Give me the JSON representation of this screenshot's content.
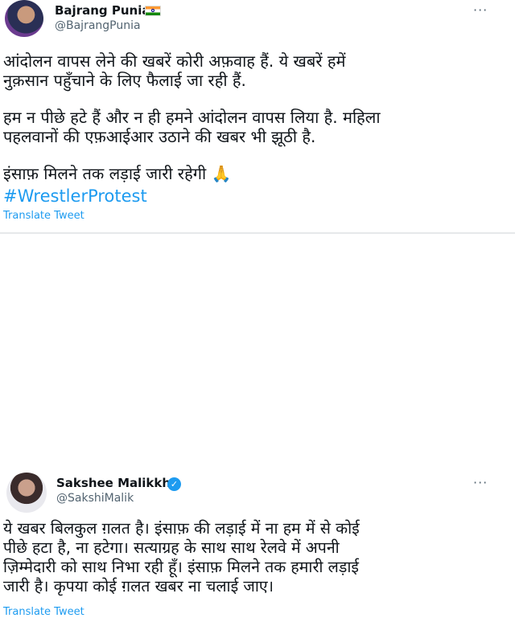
{
  "tweet1": {
    "name": "Bajrang Punia",
    "flag_icon": "india-flag-icon",
    "handle": "@BajrangPunia",
    "more_label": "···",
    "para1": "आंदोलन वापस लेने की खबरें कोरी अफ़वाह हैं. ये खबरें हमें\nनुक़सान पहुँचाने के लिए फैलाई जा रही हैं.",
    "para2": "हम न पीछे हटे हैं और न ही हमने आंदोलन वापस लिया है. महिला\nपहलवानों की एफ़आईआर उठाने की खबर भी झूठी है.",
    "para3": "इंसाफ़ मिलने तक लड़ाई जारी रहेगी 🙏",
    "hashtag": "#WrestlerProtest",
    "translate": "Translate Tweet"
  },
  "tweet2": {
    "name": "Sakshee Malikkh",
    "verified_icon": "verified-badge-icon",
    "handle": "@SakshiMalik",
    "more_label": "···",
    "body": "ये खबर बिलकुल ग़लत है। इंसाफ़ की लड़ाई में ना हम में से कोई\nपीछे हटा है, ना हटेगा। सत्याग्रह के साथ साथ रेलवे में अपनी\nज़िम्मेदारी को साथ निभा रही हूँ। इंसाफ़ मिलने तक हमारी लड़ाई\nजारी है। कृपया कोई ग़लत खबर ना चलाई जाए।",
    "translate": "Translate Tweet"
  },
  "colors": {
    "link": "#1d9bf0",
    "text": "#0f1419",
    "secondary": "#536471"
  }
}
